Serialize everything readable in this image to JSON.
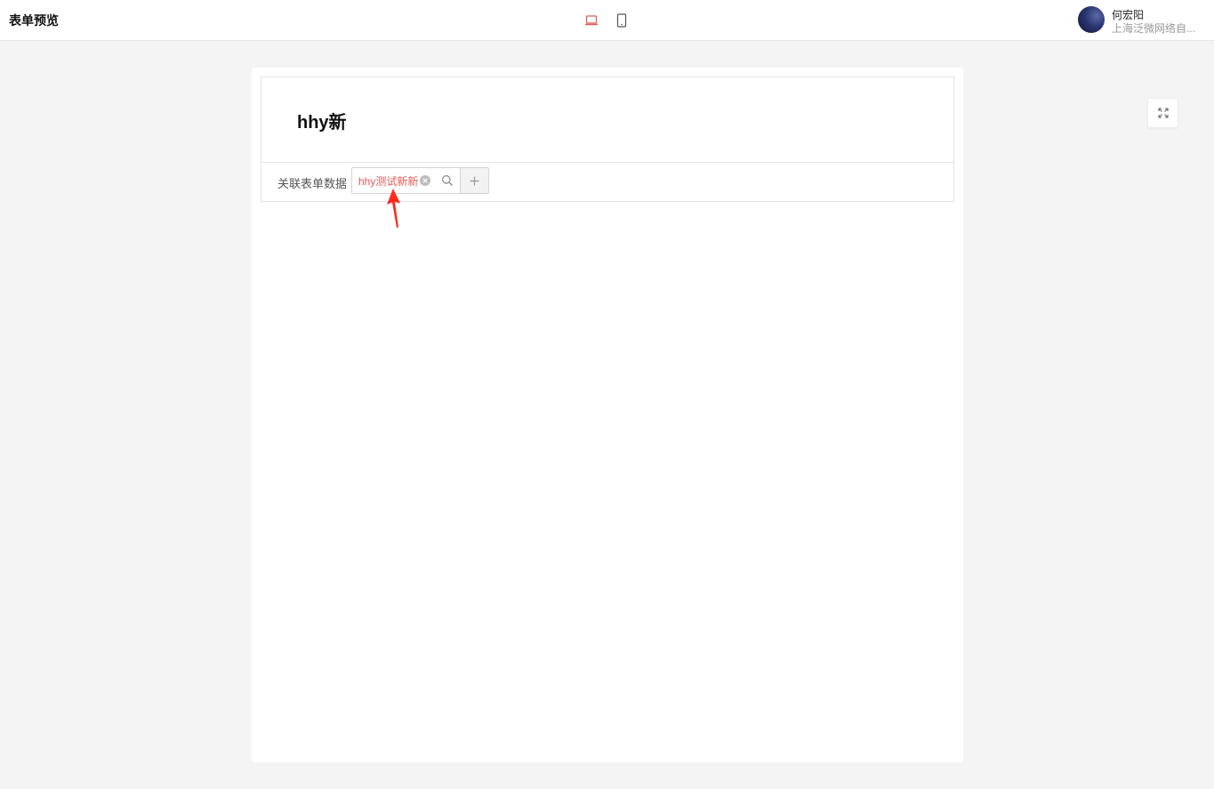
{
  "header": {
    "title": "表单预览",
    "device_icons": [
      "laptop-icon",
      "mobile-icon"
    ],
    "active_device": "desktop"
  },
  "user": {
    "name": "何宏阳",
    "org": "上海泛微网络自..."
  },
  "form": {
    "title": "hhy新",
    "field": {
      "label": "关联表单数据",
      "value": "hhy测试新新"
    }
  },
  "colors": {
    "accent": "#e05a55",
    "background": "#f4f4f4",
    "annotation": "#ff2a1a"
  }
}
